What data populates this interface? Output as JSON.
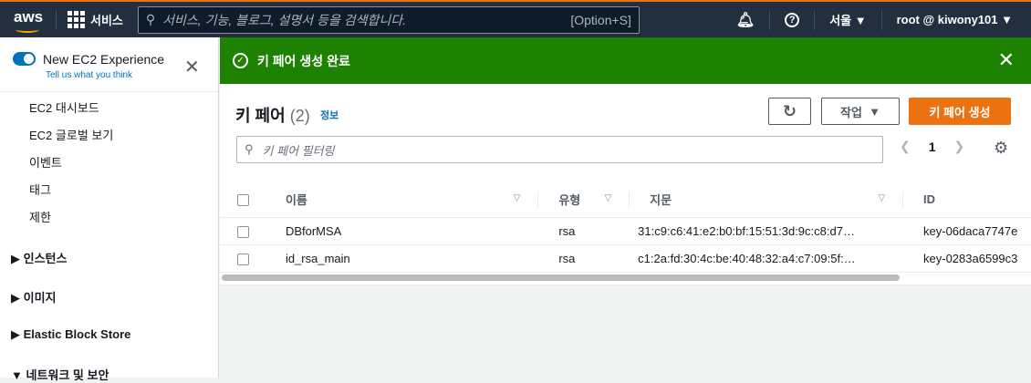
{
  "topbar": {
    "logo": "aws",
    "services": "서비스",
    "search_placeholder": "서비스, 기능, 블로그, 설명서 등을 검색합니다.",
    "shortcut": "[Option+S]",
    "region": "서울 ▼",
    "account": "root @ kiwony101 ▼"
  },
  "sidebar": {
    "experience_title": "New EC2 Experience",
    "feedback_link": "Tell us what you think",
    "items": [
      "EC2 대시보드",
      "EC2 글로벌 보기",
      "이벤트",
      "태그",
      "제한"
    ],
    "sections": [
      "인스턴스",
      "이미지",
      "Elastic Block Store",
      "네트워크 및 보안"
    ]
  },
  "flash": {
    "message": "키 페어 생성 완료"
  },
  "main": {
    "title": "키 페어",
    "count": "(2)",
    "info": "정보",
    "actions_label": "작업",
    "create_label": "키 페어 생성",
    "filter_placeholder": "키 페어 필터링",
    "page": "1",
    "columns": [
      "이름",
      "유형",
      "지문",
      "ID"
    ],
    "rows": [
      {
        "name": "DBforMSA",
        "type": "rsa",
        "fingerprint": "31:c9:c6:41:e2:b0:bf:15:51:3d:9c:c8:d7…",
        "id": "key-06daca7747e"
      },
      {
        "name": "id_rsa_main",
        "type": "rsa",
        "fingerprint": "c1:2a:fd:30:4c:be:40:48:32:a4:c7:09:5f:…",
        "id": "key-0283a6599c3"
      }
    ]
  }
}
